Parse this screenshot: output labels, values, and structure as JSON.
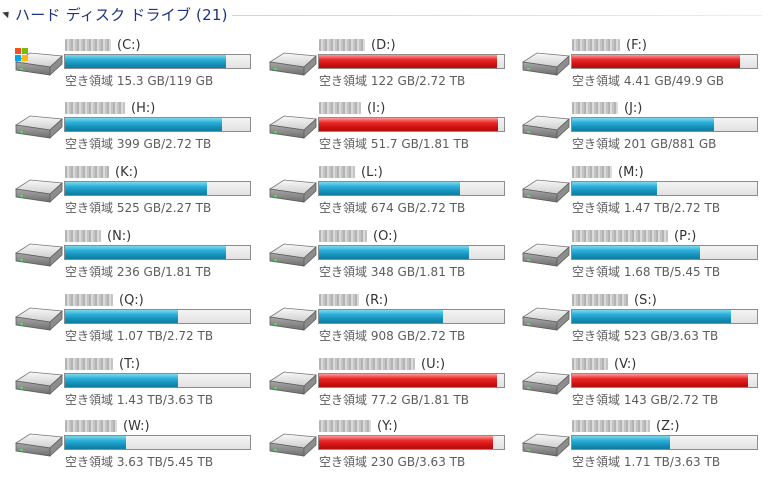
{
  "group": {
    "title": "ハード ディスク ドライブ (21)"
  },
  "colors": {
    "normal_fill": "#1a95c2",
    "low_space_fill": "#d81a1a",
    "header_text": "#1e3287"
  },
  "drives": [
    {
      "letter": "(C:)",
      "free_text": "空き領域 15.3 GB/119 GB",
      "used_fraction": 0.87,
      "status": "normal",
      "icon": "windows-system-drive-icon"
    },
    {
      "letter": "(D:)",
      "free_text": "空き領域 122 GB/2.72 TB",
      "used_fraction": 0.96,
      "status": "low",
      "icon": "hard-drive-icon"
    },
    {
      "letter": "(F:)",
      "free_text": "空き領域 4.41 GB/49.9 GB",
      "used_fraction": 0.91,
      "status": "low",
      "icon": "hard-drive-icon"
    },
    {
      "letter": "(H:)",
      "free_text": "空き領域 399 GB/2.72 TB",
      "used_fraction": 0.85,
      "status": "normal",
      "icon": "hard-drive-icon"
    },
    {
      "letter": "(I:)",
      "free_text": "空き領域 51.7 GB/1.81 TB",
      "used_fraction": 0.97,
      "status": "low",
      "icon": "hard-drive-icon"
    },
    {
      "letter": "(J:)",
      "free_text": "空き領域 201 GB/881 GB",
      "used_fraction": 0.77,
      "status": "normal",
      "icon": "hard-drive-icon"
    },
    {
      "letter": "(K:)",
      "free_text": "空き領域 525 GB/2.27 TB",
      "used_fraction": 0.77,
      "status": "normal",
      "icon": "hard-drive-icon"
    },
    {
      "letter": "(L:)",
      "free_text": "空き領域 674 GB/2.72 TB",
      "used_fraction": 0.76,
      "status": "normal",
      "icon": "hard-drive-icon"
    },
    {
      "letter": "(M:)",
      "free_text": "空き領域 1.47 TB/2.72 TB",
      "used_fraction": 0.46,
      "status": "normal",
      "icon": "hard-drive-icon"
    },
    {
      "letter": "(N:)",
      "free_text": "空き領域 236 GB/1.81 TB",
      "used_fraction": 0.87,
      "status": "normal",
      "icon": "hard-drive-icon"
    },
    {
      "letter": "(O:)",
      "free_text": "空き領域 348 GB/1.81 TB",
      "used_fraction": 0.81,
      "status": "normal",
      "icon": "hard-drive-icon"
    },
    {
      "letter": "(P:)",
      "free_text": "空き領域 1.68 TB/5.45 TB",
      "used_fraction": 0.69,
      "status": "normal",
      "icon": "hard-drive-icon"
    },
    {
      "letter": "(Q:)",
      "free_text": "空き領域 1.07 TB/2.72 TB",
      "used_fraction": 0.61,
      "status": "normal",
      "icon": "hard-drive-icon"
    },
    {
      "letter": "(R:)",
      "free_text": "空き領域 908 GB/2.72 TB",
      "used_fraction": 0.67,
      "status": "normal",
      "icon": "hard-drive-icon"
    },
    {
      "letter": "(S:)",
      "free_text": "空き領域 523 GB/3.63 TB",
      "used_fraction": 0.86,
      "status": "normal",
      "icon": "hard-drive-icon"
    },
    {
      "letter": "(T:)",
      "free_text": "空き領域 1.43 TB/3.63 TB",
      "used_fraction": 0.61,
      "status": "normal",
      "icon": "hard-drive-icon"
    },
    {
      "letter": "(U:)",
      "free_text": "空き領域 77.2 GB/1.81 TB",
      "used_fraction": 0.96,
      "status": "low",
      "icon": "hard-drive-icon"
    },
    {
      "letter": "(V:)",
      "free_text": "空き領域 143 GB/2.72 TB",
      "used_fraction": 0.95,
      "status": "low",
      "icon": "hard-drive-icon"
    },
    {
      "letter": "(W:)",
      "free_text": "空き領域 3.63 TB/5.45 TB",
      "used_fraction": 0.33,
      "status": "normal",
      "icon": "hard-drive-icon"
    },
    {
      "letter": "(Y:)",
      "free_text": "空き領域 230 GB/3.63 TB",
      "used_fraction": 0.94,
      "status": "low",
      "icon": "hard-drive-icon"
    },
    {
      "letter": "(Z:)",
      "free_text": "空き領域 1.71 TB/3.63 TB",
      "used_fraction": 0.53,
      "status": "normal",
      "icon": "hard-drive-icon"
    }
  ]
}
